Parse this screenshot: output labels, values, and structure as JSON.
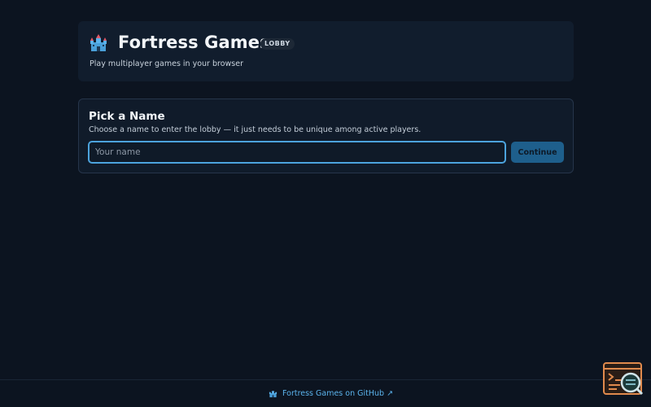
{
  "header": {
    "icon": "castle-icon",
    "title": "Fortress Games",
    "badge": "LOBBY",
    "subtitle": "Play multiplayer games in your browser"
  },
  "name_card": {
    "title": "Pick a Name",
    "description": "Choose a name to enter the lobby — it just needs to be unique among active players.",
    "input": {
      "value": "",
      "placeholder": "Your name"
    },
    "continue_label": "Continue"
  },
  "footer": {
    "icon": "castle-icon",
    "link_label": "Fortress Games on GitHub ↗"
  },
  "widget": {
    "icon": "terminal-search-icon"
  },
  "colors": {
    "background": "#0c1420",
    "card": "#111d2d",
    "accent": "#4ca3dd",
    "button": "#1e5f8c",
    "link": "#5bb3ec",
    "widget": "#e08a4d"
  }
}
